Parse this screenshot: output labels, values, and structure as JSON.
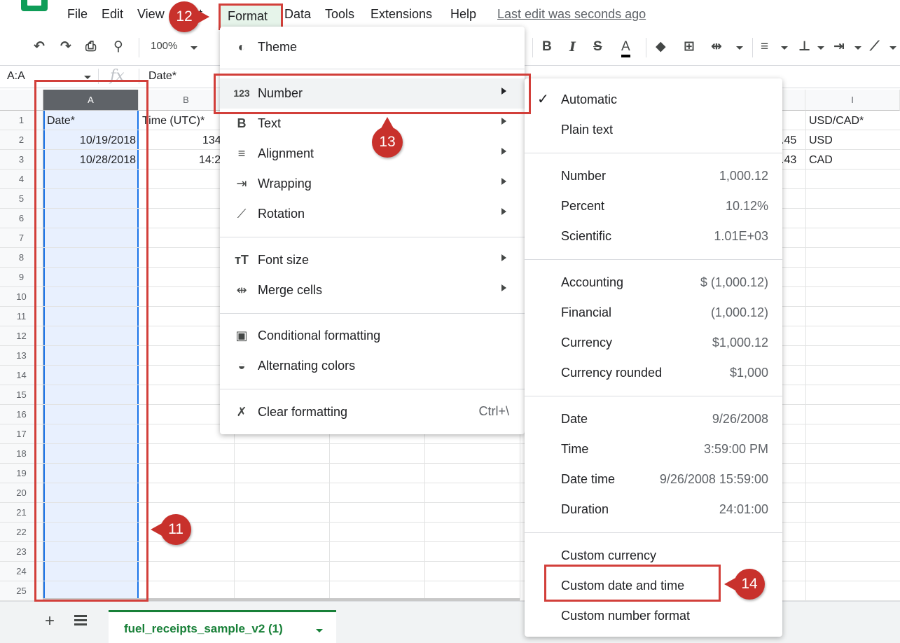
{
  "menubar": {
    "items": [
      "File",
      "Edit",
      "View",
      "Insert",
      "Format",
      "Data",
      "Tools",
      "Extensions",
      "Help"
    ],
    "visible_fragment_insert": "t",
    "last_edit": "Last edit was seconds ago"
  },
  "toolbar": {
    "zoom": "100%",
    "bold": "B",
    "italic": "I",
    "strike": "S",
    "text_color": "A"
  },
  "formula_bar": {
    "name_box": "A:A",
    "fx": "fx",
    "value": "Date*"
  },
  "grid": {
    "columns": [
      "A",
      "B",
      "I"
    ],
    "rows": [
      "1",
      "2",
      "3",
      "4",
      "5",
      "6",
      "7",
      "8",
      "9",
      "10",
      "11",
      "12",
      "13",
      "14",
      "15",
      "16",
      "17",
      "18",
      "19",
      "20",
      "21",
      "22",
      "23",
      "24",
      "25"
    ],
    "a1": "Date*",
    "a2": "10/19/2018",
    "a3": "10/28/2018",
    "b1": "Time (UTC)*",
    "b2": "134",
    "b3": "14:2",
    "h2": ".45",
    "h3": ".43",
    "i1": "USD/CAD*",
    "i2": "USD",
    "i3": "CAD"
  },
  "format_menu": {
    "theme": "Theme",
    "number": "Number",
    "text": "Text",
    "alignment": "Alignment",
    "wrapping": "Wrapping",
    "rotation": "Rotation",
    "font_size": "Font size",
    "merge_cells": "Merge cells",
    "conditional_formatting": "Conditional formatting",
    "alternating_colors": "Alternating colors",
    "clear_formatting": "Clear formatting",
    "clear_shortcut": "Ctrl+\\",
    "number_icon": "123",
    "text_icon": "B"
  },
  "number_menu": {
    "automatic": "Automatic",
    "plain_text": "Plain text",
    "number": "Number",
    "number_ex": "1,000.12",
    "percent": "Percent",
    "percent_ex": "10.12%",
    "scientific": "Scientific",
    "scientific_ex": "1.01E+03",
    "accounting": "Accounting",
    "accounting_ex": "$ (1,000.12)",
    "financial": "Financial",
    "financial_ex": "(1,000.12)",
    "currency": "Currency",
    "currency_ex": "$1,000.12",
    "currency_rounded": "Currency rounded",
    "currency_rounded_ex": "$1,000",
    "date": "Date",
    "date_ex": "9/26/2008",
    "time": "Time",
    "time_ex": "3:59:00 PM",
    "date_time": "Date time",
    "date_time_ex": "9/26/2008 15:59:00",
    "duration": "Duration",
    "duration_ex": "24:01:00",
    "custom_currency": "Custom currency",
    "custom_date_time": "Custom date and time",
    "custom_number": "Custom number format"
  },
  "sheet_tabs": {
    "active": "fuel_receipts_sample_v2 (1)",
    "add": "+"
  },
  "annotations": {
    "step11": "11",
    "step12": "12",
    "step13": "13",
    "step14": "14"
  },
  "colors": {
    "accent_red": "#d23f3a",
    "sheet_green": "#188038",
    "selection_blue": "#1a73e8"
  }
}
